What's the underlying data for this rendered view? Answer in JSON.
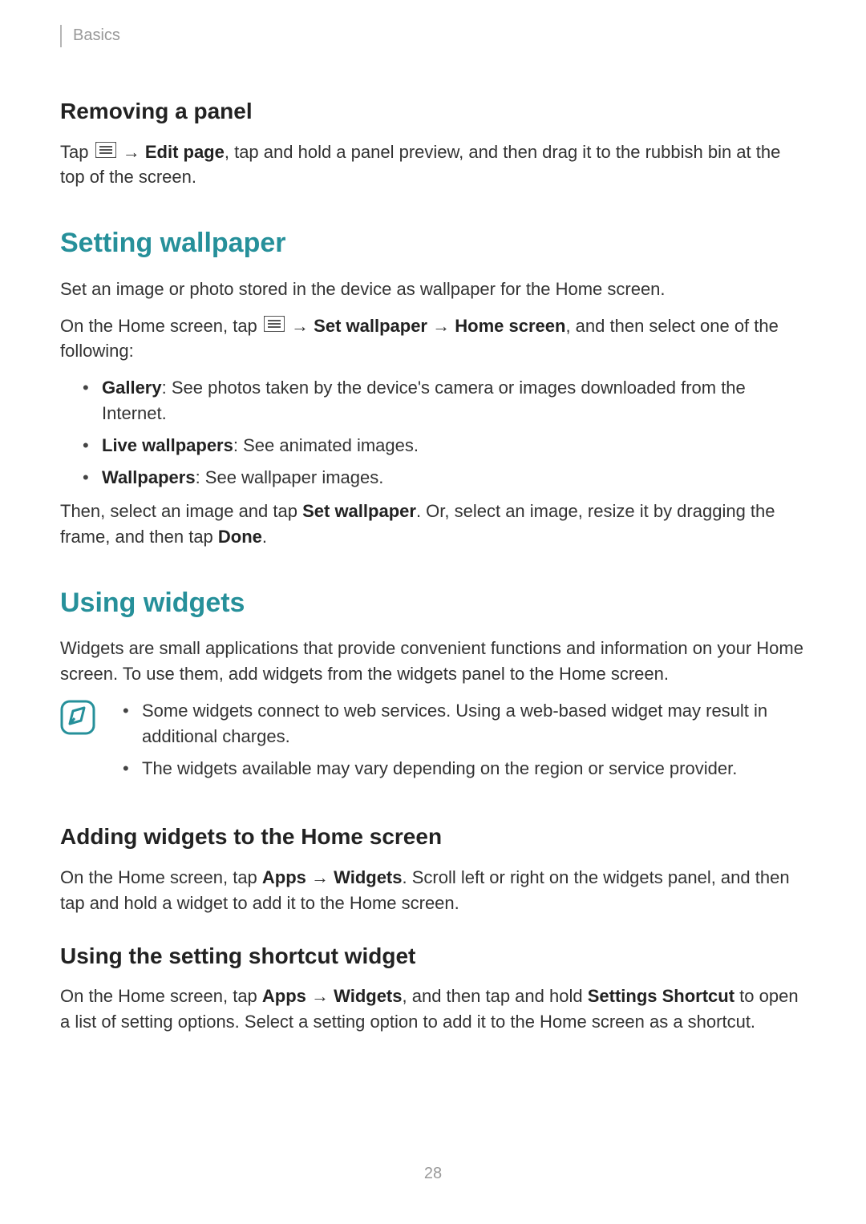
{
  "breadcrumb": "Basics",
  "removing_panel": {
    "heading": "Removing a panel",
    "p_before_icon": "Tap ",
    "p_arrow_1": " → ",
    "edit_page": "Edit page",
    "p_after": ", tap and hold a panel preview, and then drag it to the rubbish bin at the top of the screen."
  },
  "setting_wallpaper": {
    "heading": "Setting wallpaper",
    "intro": "Set an image or photo stored in the device as wallpaper for the Home screen.",
    "p2_before": "On the Home screen, tap ",
    "p2_arrow1": " → ",
    "set_wallpaper": "Set wallpaper",
    "p2_arrow2": " → ",
    "home_screen": "Home screen",
    "p2_after": ", and then select one of the following:",
    "items": [
      {
        "bold": "Gallery",
        "rest": ": See photos taken by the device's camera or images downloaded from the Internet."
      },
      {
        "bold": "Live wallpapers",
        "rest": ": See animated images."
      },
      {
        "bold": "Wallpapers",
        "rest": ": See wallpaper images."
      }
    ],
    "p3_before": "Then, select an image and tap ",
    "p3_bold": "Set wallpaper",
    "p3_mid": ". Or, select an image, resize it by dragging the frame, and then tap ",
    "done": "Done",
    "p3_after": "."
  },
  "using_widgets": {
    "heading": "Using widgets",
    "intro": "Widgets are small applications that provide convenient functions and information on your Home screen. To use them, add widgets from the widgets panel to the Home screen.",
    "notes": [
      "Some widgets connect to web services. Using a web-based widget may result in additional charges.",
      "The widgets available may vary depending on the region or service provider."
    ],
    "adding": {
      "heading": "Adding widgets to the Home screen",
      "p_before": "On the Home screen, tap ",
      "apps": "Apps",
      "arrow": " → ",
      "widgets": "Widgets",
      "p_after": ". Scroll left or right on the widgets panel, and then tap and hold a widget to add it to the Home screen."
    },
    "shortcut": {
      "heading": "Using the setting shortcut widget",
      "p_before": "On the Home screen, tap ",
      "apps": "Apps",
      "arrow": " → ",
      "widgets": "Widgets",
      "mid": ", and then tap and hold ",
      "settings_shortcut": "Settings Shortcut",
      "p_after": " to open a list of setting options. Select a setting option to add it to the Home screen as a shortcut."
    }
  },
  "page_number": "28"
}
